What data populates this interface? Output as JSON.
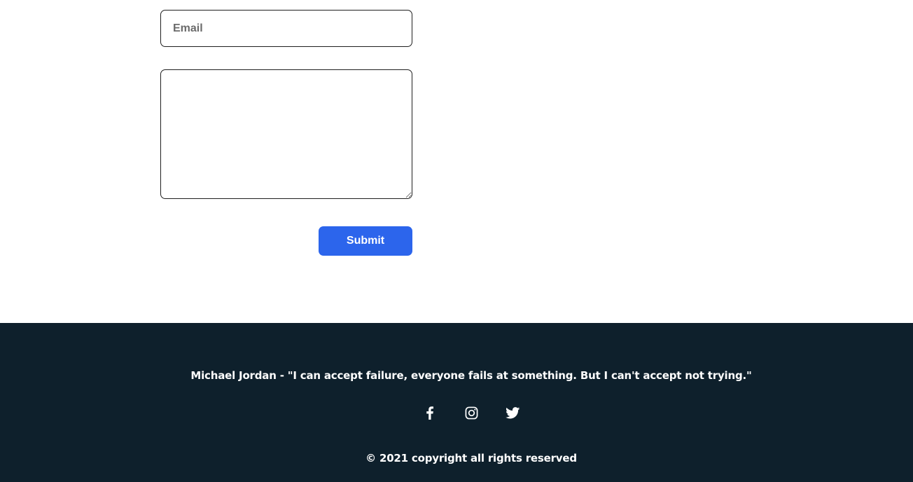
{
  "form": {
    "email": {
      "value": "",
      "placeholder": "Email"
    },
    "message": {
      "value": "",
      "placeholder": ""
    },
    "submit_label": "Submit",
    "submit_color": "#2c65ec"
  },
  "footer": {
    "background": "#0e202c",
    "quote": "Michael Jordan - \"I can accept failure, everyone fails at something. But I can't accept not trying.\"",
    "social": [
      {
        "name": "facebook",
        "icon": "facebook-icon"
      },
      {
        "name": "instagram",
        "icon": "instagram-icon"
      },
      {
        "name": "twitter",
        "icon": "twitter-icon"
      }
    ],
    "copyright": "© 2021 copyright all rights reserved"
  }
}
